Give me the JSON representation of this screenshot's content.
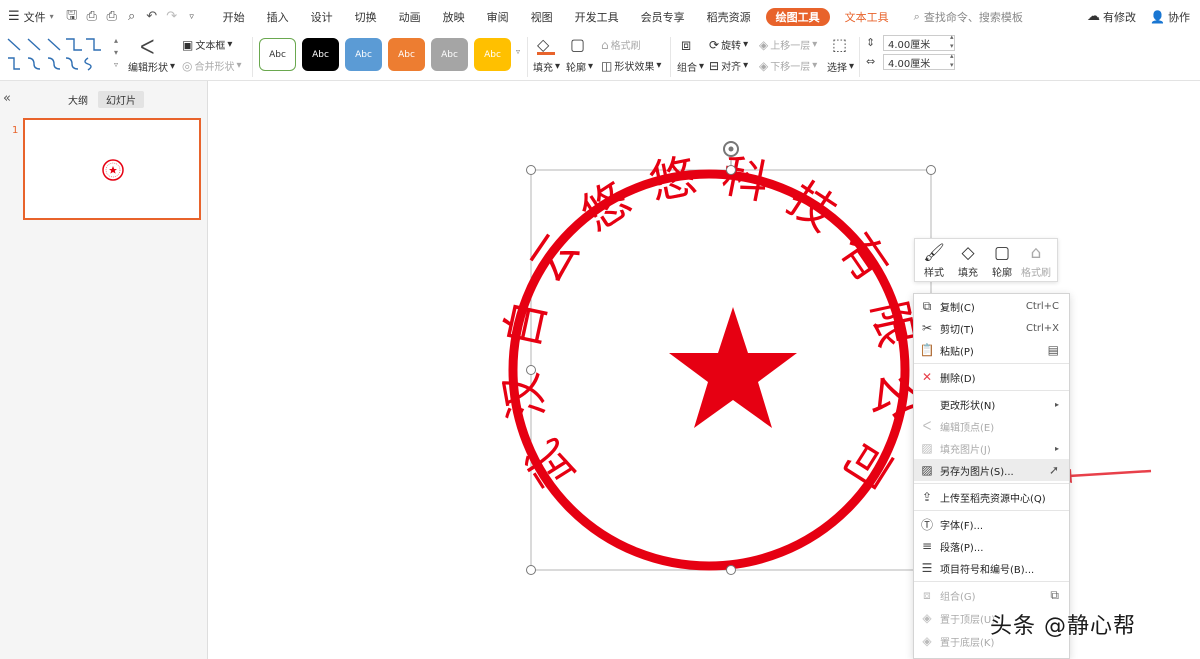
{
  "menubar": {
    "file": "文件",
    "tabs": [
      "开始",
      "插入",
      "设计",
      "切换",
      "动画",
      "放映",
      "审阅",
      "视图",
      "开发工具",
      "会员专享",
      "稻壳资源"
    ],
    "active_tab": "绘图工具",
    "text_tool_tab": "文本工具",
    "search_placeholder": "查找命令、搜索模板",
    "has_changes": "有修改",
    "collab": "协作"
  },
  "ribbon": {
    "edit_shape": "编辑形状",
    "text_box": "文本框",
    "merge_shape": "合并形状",
    "style_sample": "Abc",
    "swatches": [
      {
        "bg": "#ffffff",
        "border": "#6aa84f",
        "fg": "#333333"
      },
      {
        "bg": "#000000",
        "border": "#000000",
        "fg": "#ffffff"
      },
      {
        "bg": "#5b9bd5",
        "border": "#5b9bd5",
        "fg": "#ffffff"
      },
      {
        "bg": "#ed7d31",
        "border": "#ed7d31",
        "fg": "#ffffff"
      },
      {
        "bg": "#a5a5a5",
        "border": "#a5a5a5",
        "fg": "#ffffff"
      },
      {
        "bg": "#ffc000",
        "border": "#ffc000",
        "fg": "#ffffff"
      }
    ],
    "fill": "填充",
    "outline": "轮廓",
    "format_painter": "格式刷",
    "shape_effects": "形状效果",
    "group": "组合",
    "rotate": "旋转",
    "align": "对齐",
    "bring_forward": "上移一层",
    "send_backward": "下移一层",
    "select": "选择",
    "height": "4.00厘米",
    "width": "4.00厘米"
  },
  "panel": {
    "outline_tab": "大纲",
    "slides_tab": "幻灯片",
    "slide_number": "1"
  },
  "seal": {
    "text": "武汉白云悠悠科技有限公司",
    "color": "#e60012"
  },
  "mini_toolbar": {
    "style": "样式",
    "fill": "填充",
    "outline": "轮廓",
    "format_painter": "格式刷"
  },
  "context_menu": {
    "copy": "复制(C)",
    "copy_sc": "Ctrl+C",
    "cut": "剪切(T)",
    "cut_sc": "Ctrl+X",
    "paste": "粘贴(P)",
    "delete": "删除(D)",
    "change_shape": "更改形状(N)",
    "edit_points": "编辑顶点(E)",
    "fill_picture": "填充图片(J)",
    "save_as_picture": "另存为图片(S)...",
    "upload": "上传至稻壳资源中心(Q)",
    "font": "字体(F)...",
    "paragraph": "段落(P)...",
    "bullets": "项目符号和编号(B)...",
    "group": "组合(G)",
    "bring_to_front": "置于顶层(U)",
    "send_to_back": "置于底层(K)"
  },
  "watermark": "头条 @静心帮"
}
